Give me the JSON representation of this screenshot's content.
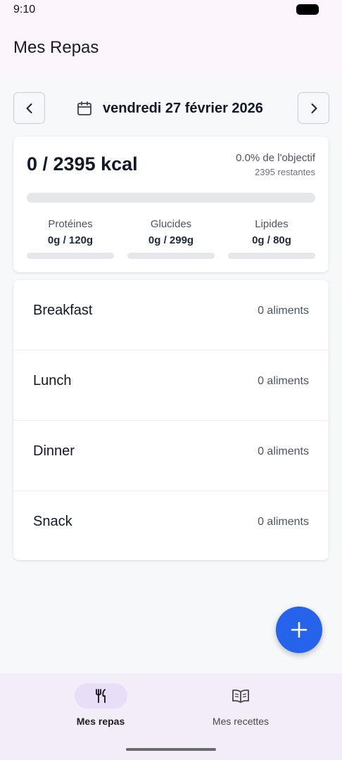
{
  "status_bar": {
    "time": "9:10"
  },
  "app_bar": {
    "title": "Mes Repas"
  },
  "date_nav": {
    "date": "vendredi 27 février 2026",
    "prev_icon": "chevron-left-icon",
    "next_icon": "chevron-right-icon",
    "calendar_icon": "calendar-icon"
  },
  "summary": {
    "kcal": "0 / 2395 kcal",
    "goal_pct": "0.0% de l'objectif",
    "remaining": "2395 restantes",
    "progress": 0,
    "macros": [
      {
        "label": "Protéines",
        "value": "0g / 120g",
        "progress": 0
      },
      {
        "label": "Glucides",
        "value": "0g / 299g",
        "progress": 0
      },
      {
        "label": "Lipides",
        "value": "0g / 80g",
        "progress": 0
      }
    ]
  },
  "meals": [
    {
      "name": "Breakfast",
      "count": "0 aliments"
    },
    {
      "name": "Lunch",
      "count": "0 aliments"
    },
    {
      "name": "Dinner",
      "count": "0 aliments"
    },
    {
      "name": "Snack",
      "count": "0 aliments"
    }
  ],
  "fab": {
    "icon": "plus-icon"
  },
  "bottom_nav": {
    "items": [
      {
        "label": "Mes repas",
        "icon": "utensils-icon",
        "active": true
      },
      {
        "label": "Mes recettes",
        "icon": "book-open-icon",
        "active": false
      }
    ]
  },
  "colors": {
    "accent": "#2563eb",
    "app_bar_bg": "#fcf5fb",
    "bottom_nav_bg": "#f3edf7",
    "nav_indicator": "#e8def8"
  }
}
